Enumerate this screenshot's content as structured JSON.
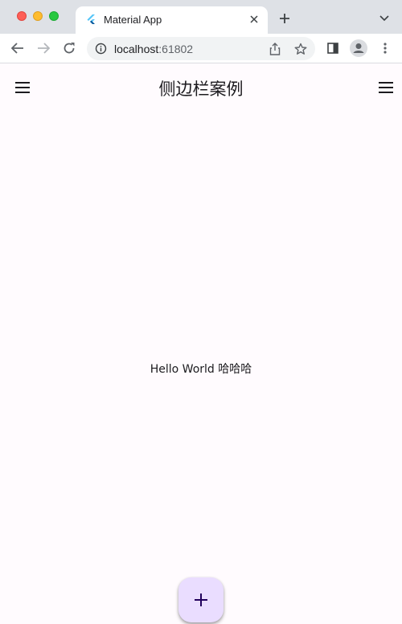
{
  "browser": {
    "tab_title": "Material App",
    "url_host": "localhost",
    "url_port": ":61802"
  },
  "app": {
    "title": "侧边栏案例",
    "body_text": "Hello World 哈哈哈",
    "fab_icon": "add-icon"
  },
  "colors": {
    "app_background": "#fffbfe",
    "fab_background": "#eaddff",
    "fab_icon": "#21005d"
  }
}
